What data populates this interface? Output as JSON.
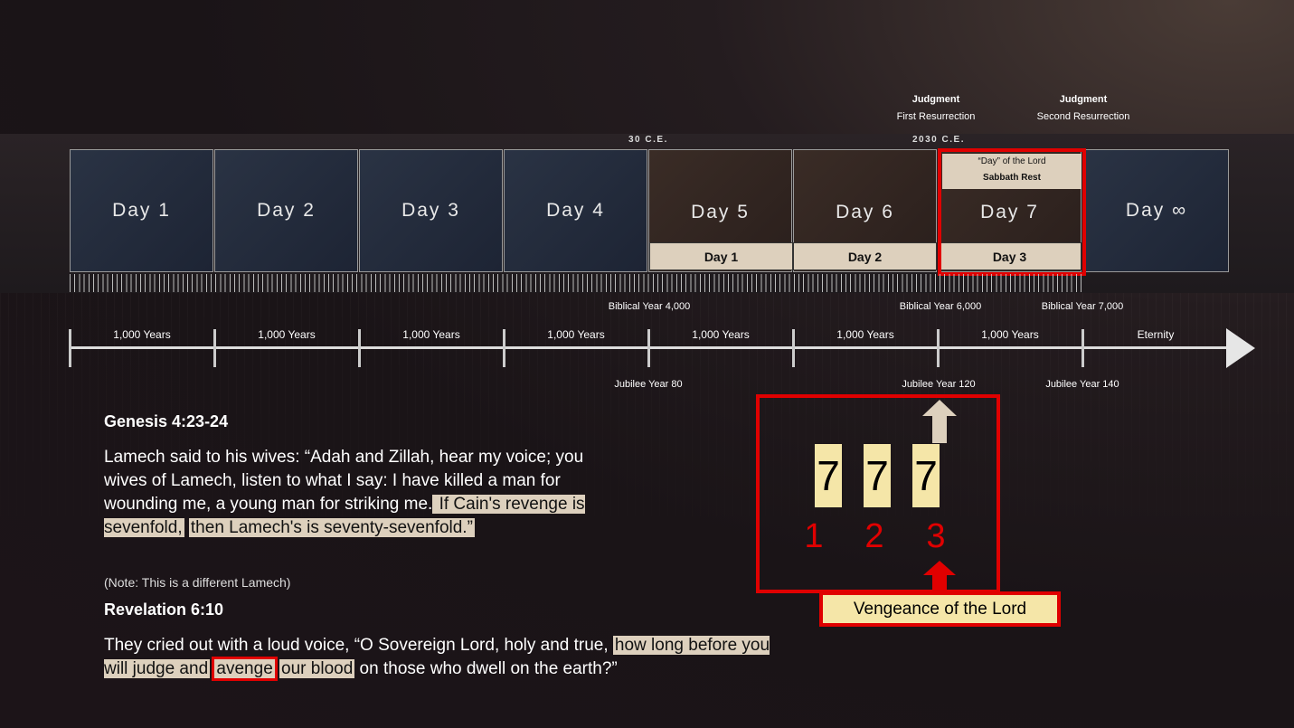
{
  "top_labels": [
    {
      "title": "Judgment",
      "subtitle": "First Resurrection"
    },
    {
      "title": "Judgment",
      "subtitle": "Second Resurrection"
    }
  ],
  "era_markers": [
    "30 C.E.",
    "2030 C.E."
  ],
  "days": [
    "Day 1",
    "Day 2",
    "Day 3",
    "Day 4",
    "Day 5",
    "Day 6",
    "Day 7",
    "Day ∞"
  ],
  "sub_days": [
    "Day 1",
    "Day 2",
    "Day 3"
  ],
  "sabbath": {
    "line1": "“Day” of the Lord",
    "line2": "Sabbath Rest"
  },
  "biblical_years": [
    "Biblical Year 4,000",
    "Biblical Year 6,000",
    "Biblical Year 7,000"
  ],
  "jubilee_years": [
    "Jubilee Year 80",
    "Jubilee Year 120",
    "Jubilee Year 140"
  ],
  "eras": [
    "1,000 Years",
    "1,000 Years",
    "1,000 Years",
    "1,000 Years",
    "1,000 Years",
    "1,000 Years",
    "1,000 Years",
    "Eternity"
  ],
  "genesis": {
    "ref": "Genesis 4:23-24",
    "plain": "Lamech said to his wives: “Adah and Zillah, hear my voice; you wives of Lamech, listen to what I say: I have killed a man for wounding me, a young man for striking me.",
    "hl1": " If Cain's revenge is sevenfold,",
    "hl2": "then Lamech's is seventy-sevenfold.”"
  },
  "note": "(Note: This is a different Lamech)",
  "revelation": {
    "ref": "Revelation 6:10",
    "plain": "They cried out with a loud voice, “O Sovereign Lord, holy and true,",
    "hl1": "how long before you will judge and",
    "hl_red": "avenge",
    "hl2": "our blood",
    "tail": " on those who dwell on the earth?”"
  },
  "sevens": [
    "7",
    "7",
    "7"
  ],
  "counts": [
    "1",
    "2",
    "3"
  ],
  "vengeance_label": "Vengeance of the Lord",
  "colors": {
    "highlight": "#ddd0bd",
    "yellow": "#f5e6a8",
    "red": "#e00000",
    "blue_day": "#262e3f",
    "brown_day": "#33261f"
  }
}
